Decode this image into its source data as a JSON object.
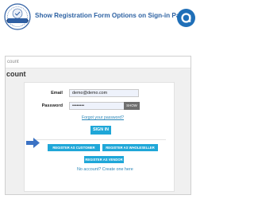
{
  "banner": {
    "title": "Show Registration Form Options on Sign-in Page",
    "badge_text": "SUCCESS QUALITY PRODUCT",
    "colors": {
      "title": "#2f63a3",
      "brand": "#1f6fb8",
      "badge_ribbon": "#2f5fa3"
    }
  },
  "shot": {
    "breadcrumb": "count",
    "heading": "count",
    "login": {
      "email_label": "Email",
      "email_value": "demo@demo.com",
      "password_label": "Password",
      "password_value": "••••••••",
      "show_label": "SHOW",
      "forgot_link": "Forgot your password?",
      "signin_label": "SIGN IN"
    },
    "register": {
      "customer_label": "REGISTER AS CUSTOMER",
      "wholeseller_label": "REGISTER AS WHOLESELLER",
      "vendor_label": "REGISTER AS VENDOR",
      "no_account": "No account? Create one here"
    },
    "colors": {
      "button": "#1fa7d8",
      "link": "#2a86b8",
      "arrow": "#3b72c4"
    }
  }
}
